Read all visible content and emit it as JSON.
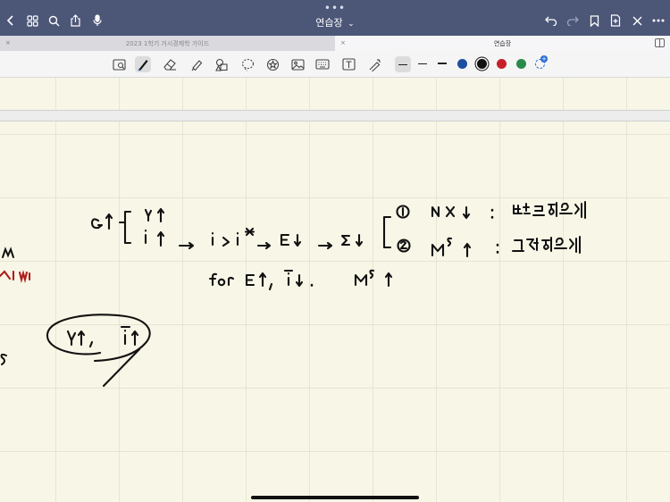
{
  "window": {
    "title": "연습장",
    "title_chevron": "⌄",
    "more_dots": "•••"
  },
  "tabs": [
    {
      "label": "2023 1학기 거시경제학 가이드",
      "active": false,
      "close": "×"
    },
    {
      "label": "연습장",
      "active": true,
      "close": "×"
    }
  ],
  "colors": {
    "topbar": "#4c5677",
    "paper": "#f8f6e6",
    "grid": "#dcdac8",
    "ink": "#111111",
    "red_ink": "#b01c1c",
    "swatch_blue": "#1d4fa0",
    "swatch_black": "#111111",
    "swatch_red": "#c8202a",
    "swatch_green": "#2a8a4c"
  },
  "toolbar": {
    "tools": [
      "lasso-image-icon",
      "pen-icon",
      "eraser-icon",
      "highlighter-icon",
      "shapes-icon",
      "lasso-icon",
      "sticker-icon",
      "image-icon",
      "keyboard-icon",
      "textbox-icon",
      "laser-pointer-icon"
    ],
    "selected_tool": "pen-icon"
  }
}
